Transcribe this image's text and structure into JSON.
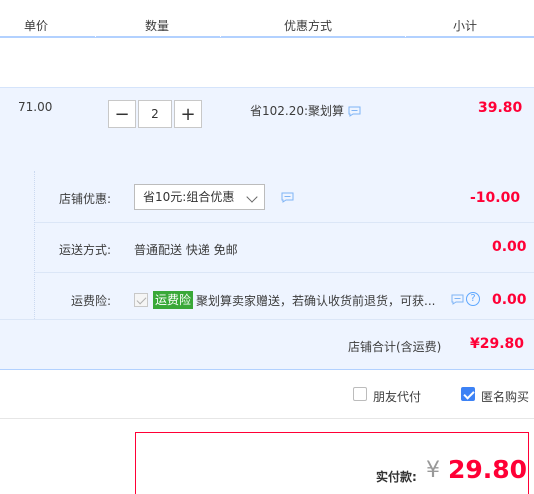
{
  "header": {
    "col_price": "单价",
    "col_qty": "数量",
    "col_promo": "优惠方式",
    "col_subtotal": "小计"
  },
  "item": {
    "price": "71.00",
    "qty": "2",
    "qty_minus": "−",
    "qty_plus": "+",
    "promo": "省102.20:聚划算",
    "subtotal": "39.80"
  },
  "shop": {
    "discount_label": "店铺优惠:",
    "discount_selected": "省10元:组合优惠",
    "discount_amount": "-10.00",
    "shipping_label": "运送方式:",
    "shipping_text": "普通配送 快递 免邮",
    "shipping_amount": "0.00",
    "insurance_label": "运费险:",
    "insurance_tag": "运费险",
    "insurance_text": "聚划算卖家赠送，若确认收货前退货，可获...",
    "insurance_amount": "0.00",
    "total_label": "店铺合计(含运费)",
    "total_amount": "¥29.80"
  },
  "options": {
    "friend_pay": "朋友代付",
    "friend_pay_checked": false,
    "anonymous": "匿名购买",
    "anonymous_checked": true
  },
  "pay": {
    "label": "实付款:",
    "symbol": "¥",
    "amount": "29.80"
  },
  "colors": {
    "accent_red": "#ff0036",
    "tag_green": "#39a838",
    "light_blue_bg": "#eef4ff",
    "checkbox_blue": "#3d82f5"
  }
}
